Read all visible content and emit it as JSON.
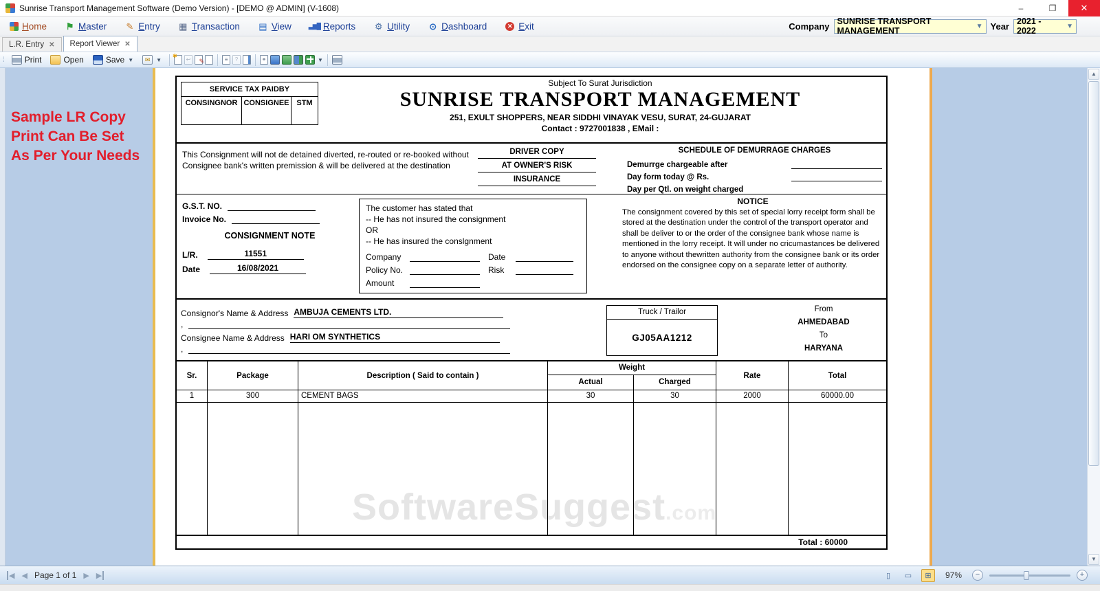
{
  "window": {
    "title": "Sunrise Transport Management Software (Demo Version) - [DEMO @ ADMIN] (V-1608)",
    "minimize": "–",
    "maximize": "❒",
    "close": "✕"
  },
  "menu": {
    "items": [
      {
        "label": "Home",
        "icon": "home-grid-icon"
      },
      {
        "label": "Master",
        "icon": "flag-icon"
      },
      {
        "label": "Entry",
        "icon": "pencil-icon"
      },
      {
        "label": "Transaction",
        "icon": "ledger-icon"
      },
      {
        "label": "View",
        "icon": "window-icon"
      },
      {
        "label": "Reports",
        "icon": "bar-chart-icon"
      },
      {
        "label": "Utility",
        "icon": "gear-icon"
      },
      {
        "label": "Dashboard",
        "icon": "gauge-icon"
      },
      {
        "label": "Exit",
        "icon": "exit-icon"
      }
    ],
    "company_label": "Company",
    "company_value": "SUNRISE TRANSPORT MANAGEMENT",
    "year_label": "Year",
    "year_value": "2021 - 2022"
  },
  "tabs": [
    {
      "label": "L.R. Entry"
    },
    {
      "label": "Report Viewer"
    }
  ],
  "toolbar": {
    "print_label": "Print",
    "open_label": "Open",
    "save_label": "Save",
    "icons": [
      "export",
      "add-page",
      "revert-page",
      "edit-page",
      "blank-page",
      "text-page",
      "clipboard-help",
      "page-setup",
      "find",
      "monitor",
      "single-page-green",
      "double-page",
      "page-grid",
      "printer-export"
    ]
  },
  "note": {
    "lines": [
      "Sample LR Copy",
      "Print Can Be Set",
      "As Per Your Needs"
    ],
    "color": "#e21e2b"
  },
  "report": {
    "jurisdiction": "Subject To Surat Jurisdiction",
    "company_name": "SUNRISE TRANSPORT MANAGEMENT",
    "address": "251, EXULT SHOPPERS, NEAR SIDDHI VINAYAK VESU, SURAT, 24-GUJARAT",
    "contact": "Contact : 9727001838 , EMail :",
    "service_tax": {
      "title": "SERVICE TAX PAIDBY",
      "cols": [
        "CONSINGNOR",
        "CONSIGNEE",
        "STM"
      ]
    },
    "clause": "This Consignment will not de detained diverted, re-routed or re-booked without Consignee bank's written premission & will be delivered at the destination",
    "copies": [
      "DRIVER COPY",
      "AT OWNER'S RISK",
      "INSURANCE"
    ],
    "demurrage": {
      "title": "SCHEDULE OF DEMURRAGE CHARGES",
      "lines": [
        "Demurrge chargeable after",
        "Day form today @ Rs.",
        "Day per Qtl. on weight charged"
      ]
    },
    "gst_label": "G.S.T. NO.",
    "invoice_label": "Invoice No.",
    "consignment_note_title": "CONSIGNMENT NOTE",
    "lr_label": "L/R.",
    "lr_value": "11551",
    "date_label": "Date",
    "date_value": "16/08/2021",
    "insurance_box": {
      "line1": "The customer has stated that",
      "line2": "-- He has not insured the consignment",
      "line3": "OR",
      "line4": "-- He has insured the conslgnment",
      "company_label": "Company",
      "date_label": "Date",
      "policy_label": "Policy No.",
      "risk_label": "Risk",
      "amount_label": "Amount"
    },
    "notice": {
      "title": "NOTICE",
      "body": "The consignment covered by this set of special lorry receipt form shall be stored at the destination under the control of the transport operator and shall be deliver to or the order of the consignee bank whose name is mentioned in the lorry receipt. It will under no cricumastances be delivered to anyone without thewritten authority from the consignee bank or its order endorsed on the consignee copy on a separate letter of authority."
    },
    "consignor_label": "Consignor's Name & Address",
    "consignor_value": "AMBUJA CEMENTS LTD.",
    "consignee_label": "Consignee Name & Address",
    "consignee_value": "HARI OM SYNTHETICS",
    "comma": ",",
    "truck": {
      "label": "Truck / Trailor",
      "value": "GJ05AA1212"
    },
    "route": {
      "from_label": "From",
      "from_value": "AHMEDABAD",
      "to_label": "To",
      "to_value": "HARYANA"
    },
    "table": {
      "headers": {
        "sr": "Sr.",
        "package": "Package",
        "description": "Description ( Said to contain )",
        "weight": "Weight",
        "actual": "Actual",
        "charged": "Charged",
        "rate": "Rate",
        "total": "Total"
      },
      "rows": [
        {
          "sr": "1",
          "package": "300",
          "description": "CEMENT BAGS",
          "actual": "30",
          "charged": "30",
          "rate": "2000",
          "total": "60000.00"
        }
      ],
      "footer_total": "Total : 60000"
    }
  },
  "watermark": {
    "main": "SoftwareSuggest",
    "suffix": ".com"
  },
  "statusbar": {
    "page_text": "Page 1 of 1",
    "zoom_percent": "97%"
  },
  "colors": {
    "viewer_background": "#b7cce6",
    "note_red": "#e21e2b",
    "close_button_red": "#e8212e",
    "combo_yellow": "#ffffd4",
    "page_edge_yellow": "#e8bb50"
  }
}
